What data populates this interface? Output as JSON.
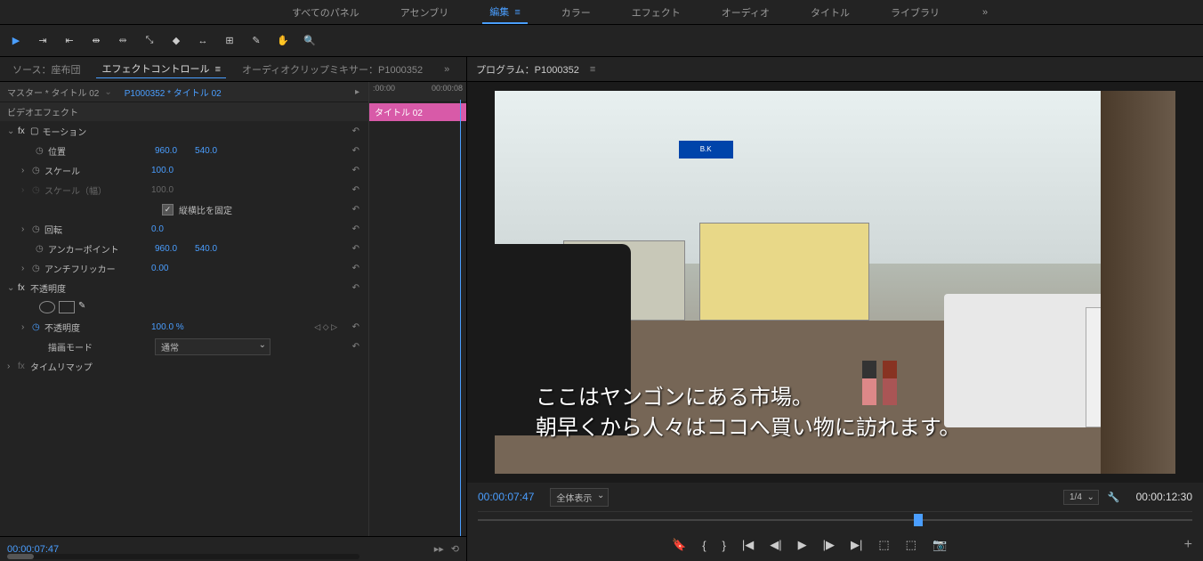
{
  "workspace": {
    "tabs": [
      "すべてのパネル",
      "アセンブリ",
      "編集",
      "カラー",
      "エフェクト",
      "オーディオ",
      "タイトル",
      "ライブラリ"
    ],
    "active_index": 2
  },
  "left_panel": {
    "source_tab": "ソース：座布団",
    "effect_controls_tab": "エフェクトコントロール",
    "audio_mixer_tab": "オーディオクリップミキサー：P1000352",
    "master_label": "マスター * タイトル 02",
    "clip_label": "P1000352 * タイトル 02",
    "ruler_start": ":00:00",
    "ruler_end": "00:00:08",
    "video_effects_header": "ビデオエフェクト",
    "title_clip_name": "タイトル 02",
    "motion": {
      "label": "モーション",
      "position_label": "位置",
      "position_x": "960.0",
      "position_y": "540.0",
      "scale_label": "スケール",
      "scale_value": "100.0",
      "scale_width_label": "スケール（幅）",
      "scale_width_value": "100.0",
      "uniform_label": "縦横比を固定",
      "rotation_label": "回転",
      "rotation_value": "0.0",
      "anchor_label": "アンカーポイント",
      "anchor_x": "960.0",
      "anchor_y": "540.0",
      "antiflicker_label": "アンチフリッカー",
      "antiflicker_value": "0.00"
    },
    "opacity": {
      "label": "不透明度",
      "opacity_prop_label": "不透明度",
      "opacity_value": "100.0 %",
      "blend_label": "描画モード",
      "blend_value": "通常"
    },
    "time_remap_label": "タイムリマップ",
    "footer_tc": "00:00:07:47"
  },
  "program": {
    "header_label": "プログラム：",
    "sequence_name": "P1000352",
    "subtitle_line1": "ここはヤンゴンにある市場。",
    "subtitle_line2": "朝早くから人々はココへ買い物に訪れます。",
    "sign_text": "B.K",
    "tc_current": "00:00:07:47",
    "fit_label": "全体表示",
    "resolution_label": "1/4",
    "tc_duration": "00:00:12:30"
  }
}
